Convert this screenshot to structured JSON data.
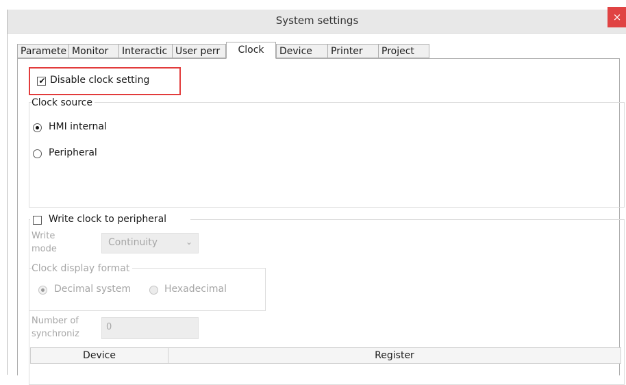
{
  "window": {
    "title": "System settings",
    "close_label": "×"
  },
  "tabs": [
    {
      "label": "Paramete",
      "active": false
    },
    {
      "label": "Monitor",
      "active": false
    },
    {
      "label": "Interactic",
      "active": false
    },
    {
      "label": "User perr",
      "active": false
    },
    {
      "label": "Clock",
      "active": true
    },
    {
      "label": "Device",
      "active": false
    },
    {
      "label": "Printer",
      "active": false
    },
    {
      "label": "Project",
      "active": false
    }
  ],
  "clock": {
    "disable_label": "Disable clock setting",
    "disable_checked": true,
    "source_group_label": "Clock source",
    "source_options": [
      {
        "label": "HMI internal",
        "selected": true
      },
      {
        "label": "Peripheral",
        "selected": false
      }
    ],
    "write_label": "Write clock to peripheral",
    "write_checked": false,
    "write_mode_label_1": "Write",
    "write_mode_label_2": "mode",
    "write_mode_value": "Continuity",
    "display_group_label": "Clock display format",
    "display_options": [
      {
        "label": "Decimal system",
        "selected": true
      },
      {
        "label": "Hexadecimal",
        "selected": false
      }
    ],
    "sync_label_1": "Number of",
    "sync_label_2": "synchroniz",
    "sync_value": "0",
    "table_headers": [
      "Device",
      "Register"
    ]
  },
  "colors": {
    "highlight_border": "#e23b3b",
    "close_button": "#e04343",
    "disabled_text": "#a6a6a6"
  }
}
